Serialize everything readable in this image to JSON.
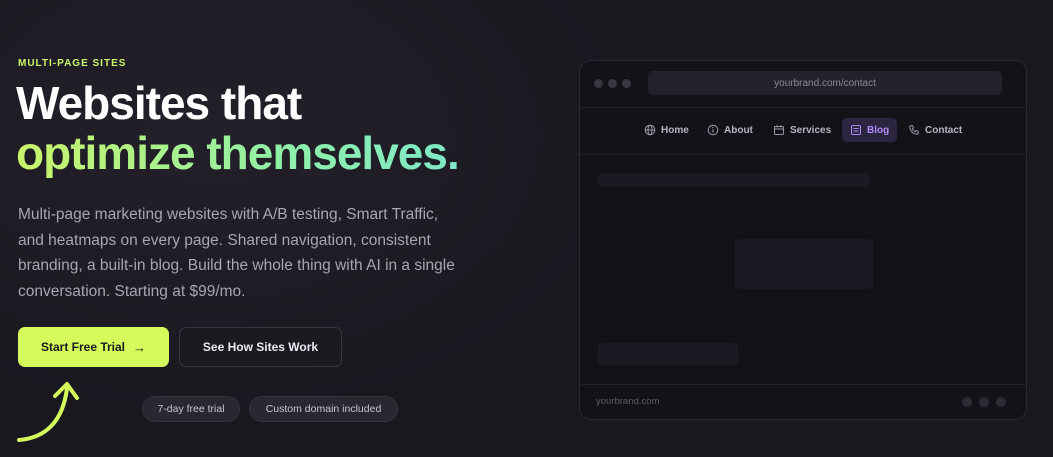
{
  "hero": {
    "eyebrow": "MULTI-PAGE SITES",
    "title_line1": "Websites that",
    "title_line2": "optimize themselves.",
    "description": "Multi-page marketing websites with A/B testing, Smart Traffic, and heatmaps on every page. Shared navigation, consistent branding, a built-in blog. Build the whole thing with AI in a single conversation. Starting at $99/mo.",
    "primary_button": "Start Free Trial",
    "secondary_button": "See How Sites Work",
    "badges": [
      "7-day free trial",
      "Custom domain included"
    ]
  },
  "browser_mock": {
    "url": "yourbrand.com/contact",
    "nav": [
      {
        "label": "Home",
        "icon": "globe-icon"
      },
      {
        "label": "About",
        "icon": "info-icon"
      },
      {
        "label": "Services",
        "icon": "calendar-icon"
      },
      {
        "label": "Blog",
        "icon": "blog-icon",
        "active": true
      },
      {
        "label": "Contact",
        "icon": "phone-icon"
      }
    ],
    "footer_text": "yourbrand.com"
  },
  "colors": {
    "accent_lime": "#d4fa5c",
    "accent_purple": "#b08cf6",
    "background": "#1a181f"
  }
}
